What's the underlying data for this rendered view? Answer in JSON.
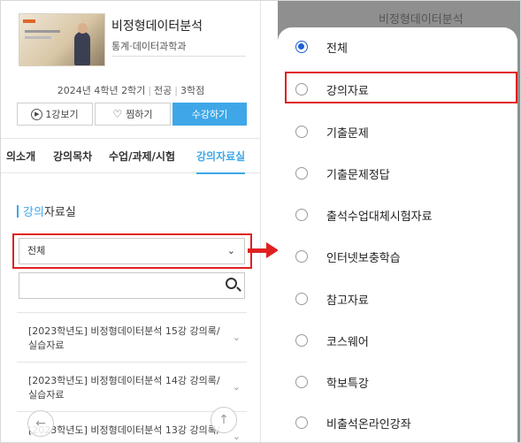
{
  "course": {
    "title": "비정형데이터분석",
    "dept": "통계·데이터과학과",
    "meta_year": "2024년 4학년 2학기",
    "meta_type": "전공",
    "meta_credit": "3학점",
    "thumb_icon": "lecture-thumbnail"
  },
  "buttons": {
    "watch_label": "1강보기",
    "wish_label": "찜하기",
    "enroll_label": "수강하기"
  },
  "tabs": [
    "의소개",
    "강의목차",
    "수업/과제/시험",
    "강의자료실"
  ],
  "section": {
    "title_blue": "강의",
    "title_rest": "자료실"
  },
  "select": {
    "value": "전체"
  },
  "list": [
    {
      "line1": "[2023학년도] 비정형데이터분석 15강 강의록/",
      "line2": "실습자료"
    },
    {
      "line1": "[2023학년도] 비정형데이터분석 14강 강의록/",
      "line2": "실습자료"
    },
    {
      "line1": "[2023학년도] 비정형데이터분석 13강 강의록/",
      "line2": ""
    }
  ],
  "right_bg_title": "비정형데이터분석",
  "options": [
    {
      "label": "전체",
      "selected": true
    },
    {
      "label": "강의자료",
      "selected": false
    },
    {
      "label": "기출문제",
      "selected": false
    },
    {
      "label": "기출문제정답",
      "selected": false
    },
    {
      "label": "출석수업대체시험자료",
      "selected": false
    },
    {
      "label": "인터넷보충학습",
      "selected": false
    },
    {
      "label": "참고자료",
      "selected": false
    },
    {
      "label": "코스웨어",
      "selected": false
    },
    {
      "label": "학보특강",
      "selected": false
    },
    {
      "label": "비출석온라인강좌",
      "selected": false
    }
  ],
  "colors": {
    "accent": "#3fa7e8",
    "highlight": "#e02020",
    "radio_on": "#1d5fd6"
  }
}
